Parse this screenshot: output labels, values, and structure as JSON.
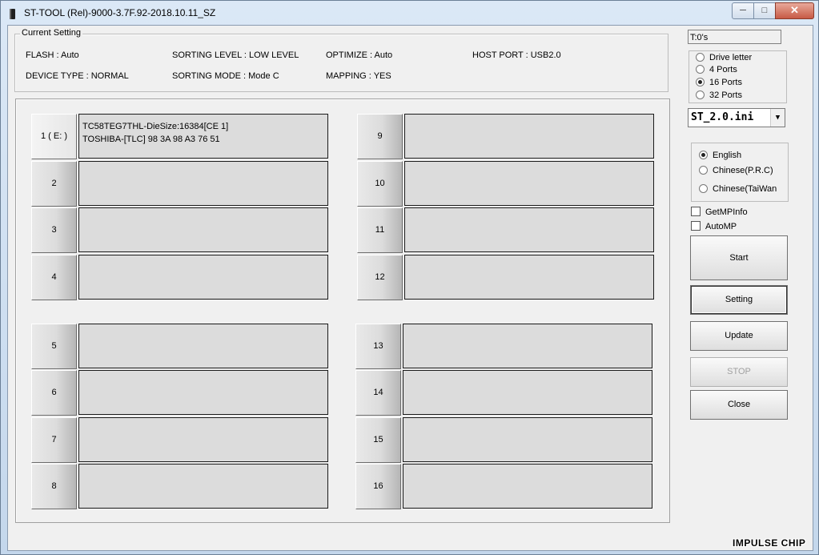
{
  "window": {
    "title": "ST-TOOL (Rel)-9000-3.7F.92-2018.10.11_SZ",
    "minimize": "─",
    "maximize": "□",
    "close": "✕"
  },
  "current_setting": {
    "title": "Current Setting",
    "flash": "FLASH : Auto",
    "sorting_level": "SORTING LEVEL : LOW LEVEL",
    "optimize": "OPTIMIZE : Auto",
    "host_port": "HOST PORT : USB2.0",
    "device_type": "DEVICE TYPE : NORMAL",
    "sorting_mode": "SORTING MODE : Mode C",
    "mapping": "MAPPING : YES"
  },
  "ports": [
    {
      "label": "1 ( E: )",
      "info": "TC58TEG7THL-DieSize:16384[CE 1]\nTOSHIBA-[TLC] 98 3A 98 A3 76 51"
    },
    {
      "label": "2",
      "info": ""
    },
    {
      "label": "3",
      "info": ""
    },
    {
      "label": "4",
      "info": ""
    },
    {
      "label": "5",
      "info": ""
    },
    {
      "label": "6",
      "info": ""
    },
    {
      "label": "7",
      "info": ""
    },
    {
      "label": "8",
      "info": ""
    },
    {
      "label": "9",
      "info": ""
    },
    {
      "label": "10",
      "info": ""
    },
    {
      "label": "11",
      "info": ""
    },
    {
      "label": "12",
      "info": ""
    },
    {
      "label": "13",
      "info": ""
    },
    {
      "label": "14",
      "info": ""
    },
    {
      "label": "15",
      "info": ""
    },
    {
      "label": "16",
      "info": ""
    }
  ],
  "timer": "T:0's",
  "port_mode": {
    "options": [
      "Drive letter",
      "4 Ports",
      "16 Ports",
      "32 Ports"
    ],
    "selected": "16 Ports"
  },
  "ini_file": {
    "value": "ST_2.0.ini",
    "arrow": "▼"
  },
  "language": {
    "options": [
      "English",
      "Chinese(P.R.C)",
      "Chinese(TaiWan"
    ],
    "selected": "English"
  },
  "checks": {
    "get_mp_info": "GetMPInfo",
    "auto_mp": "AutoMP"
  },
  "buttons": {
    "start": "Start",
    "setting": "Setting",
    "update": "Update",
    "stop": "STOP",
    "close": "Close"
  },
  "watermark": "IMPULSE CHIP"
}
